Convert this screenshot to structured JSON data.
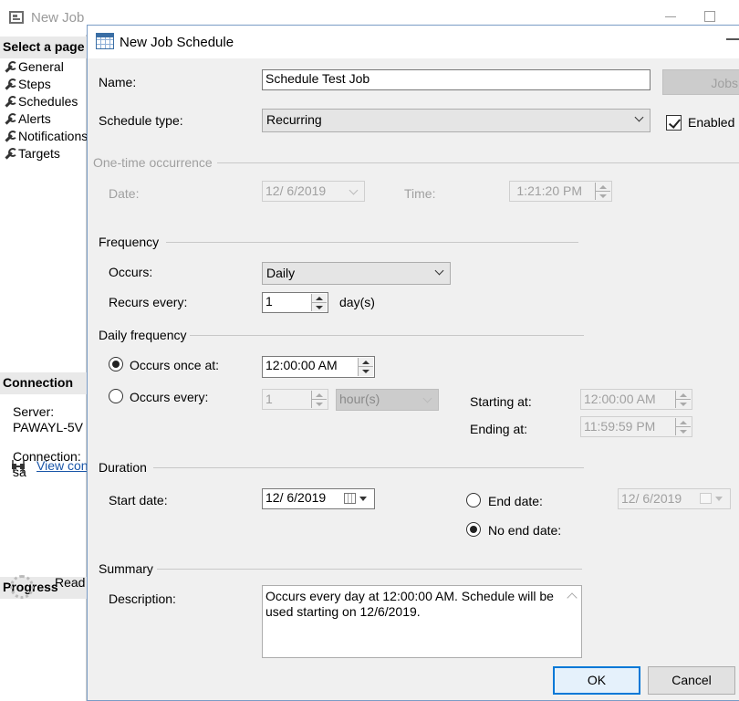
{
  "background_window": {
    "title": "New Job",
    "select_page_header": "Select a page",
    "pages": [
      "General",
      "Steps",
      "Schedules",
      "Alerts",
      "Notifications",
      "Targets"
    ],
    "connection_header": "Connection",
    "server_label": "Server:",
    "server_value": "PAWAYL-5V",
    "connection_label": "Connection:",
    "connection_value": "sa",
    "view_connection_link": "View con",
    "progress_header": "Progress",
    "progress_status": "Read"
  },
  "dialog": {
    "title": "New Job Schedule",
    "name_label": "Name:",
    "name_value": "Schedule Test Job",
    "jobs_button": "Jobs",
    "schedule_type_label": "Schedule type:",
    "schedule_type_value": "Recurring",
    "enabled_label": "Enabled",
    "enabled_checked": true,
    "one_time": {
      "header": "One-time occurrence",
      "date_label": "Date:",
      "date_value": "12/  6/2019",
      "time_label": "Time:",
      "time_value": "1:21:20 PM"
    },
    "frequency": {
      "header": "Frequency",
      "occurs_label": "Occurs:",
      "occurs_value": "Daily",
      "recurs_label": "Recurs every:",
      "recurs_value": "1",
      "recurs_unit": "day(s)"
    },
    "daily_frequency": {
      "header": "Daily frequency",
      "once_label": "Occurs once at:",
      "once_value": "12:00:00 AM",
      "once_selected": true,
      "every_label": "Occurs every:",
      "every_value": "1",
      "every_unit": "hour(s)",
      "starting_label": "Starting at:",
      "starting_value": "12:00:00 AM",
      "ending_label": "Ending at:",
      "ending_value": "11:59:59 PM"
    },
    "duration": {
      "header": "Duration",
      "start_label": "Start date:",
      "start_value": "12/  6/2019",
      "end_date_label": "End date:",
      "end_date_value": "12/  6/2019",
      "no_end_label": "No end date:",
      "no_end_selected": true
    },
    "summary": {
      "header": "Summary",
      "description_label": "Description:",
      "description_value": "Occurs every day at 12:00:00 AM. Schedule will be used starting on 12/6/2019."
    },
    "ok_button": "OK",
    "cancel_button": "Cancel"
  }
}
